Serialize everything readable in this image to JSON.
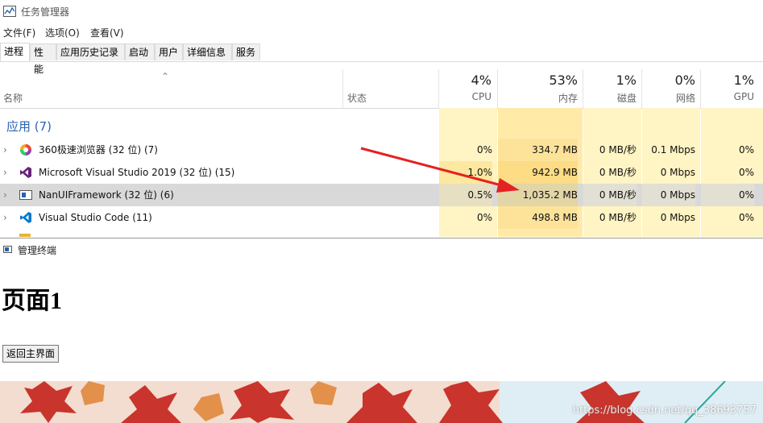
{
  "window": {
    "title": "任务管理器",
    "icon": "task-manager-icon"
  },
  "menu": [
    {
      "label": "文件(F)"
    },
    {
      "label": "选项(O)"
    },
    {
      "label": "查看(V)"
    }
  ],
  "tabs": [
    {
      "label": "进程",
      "active": true
    },
    {
      "label": "性能"
    },
    {
      "label": "应用历史记录"
    },
    {
      "label": "启动"
    },
    {
      "label": "用户"
    },
    {
      "label": "详细信息"
    },
    {
      "label": "服务"
    }
  ],
  "columns": {
    "name": "名称",
    "status": "状态",
    "cpu": {
      "percent": "4%",
      "label": "CPU"
    },
    "memory": {
      "percent": "53%",
      "label": "内存"
    },
    "disk": {
      "percent": "1%",
      "label": "磁盘"
    },
    "network": {
      "percent": "0%",
      "label": "网络"
    },
    "gpu": {
      "percent": "1%",
      "label": "GPU"
    }
  },
  "group": {
    "label": "应用 (7)"
  },
  "processes": [
    {
      "name": "360极速浏览器 (32 位) (7)",
      "icon": "browser-360-icon",
      "cpu": "0%",
      "memory": "334.7 MB",
      "disk": "0 MB/秒",
      "network": "0.1 Mbps",
      "gpu": "0%"
    },
    {
      "name": "Microsoft Visual Studio 2019 (32 位) (15)",
      "icon": "visual-studio-icon",
      "cpu": "1.0%",
      "memory": "942.9 MB",
      "disk": "0 MB/秒",
      "network": "0 Mbps",
      "gpu": "0%"
    },
    {
      "name": "NanUIFramework (32 位) (6)",
      "icon": "window-app-icon",
      "cpu": "0.5%",
      "memory": "1,035.2 MB",
      "disk": "0 MB/秒",
      "network": "0 Mbps",
      "gpu": "0%",
      "selected": true
    },
    {
      "name": "Visual Studio Code (11)",
      "icon": "vscode-icon",
      "cpu": "0%",
      "memory": "498.8 MB",
      "disk": "0 MB/秒",
      "network": "0 Mbps",
      "gpu": "0%"
    }
  ],
  "colors": {
    "heat_light": "#fff4c4",
    "heat_mid": "#ffe9a8",
    "heat_strong": "#fde08a",
    "selected_row": "#d9d9d9",
    "group_blue": "#2a62b0",
    "arrow_red": "#e32222"
  },
  "lower_window": {
    "title": "管理终端",
    "heading": "页面1",
    "back_button": "返回主界面",
    "watermark": "https://blog.csdn.net/qq_38693757"
  }
}
